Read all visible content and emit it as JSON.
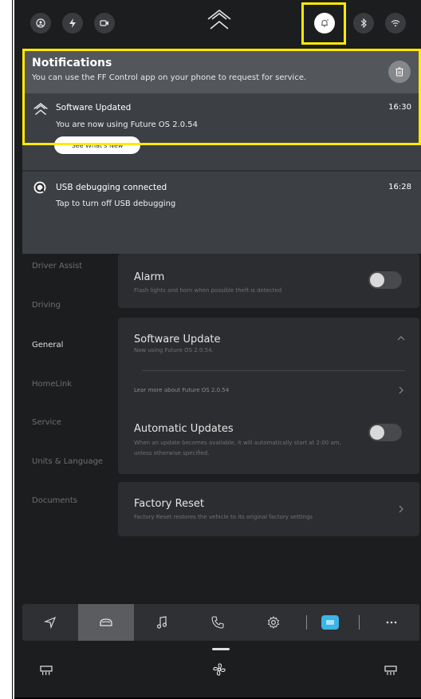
{
  "notifications": {
    "title": "Notifications",
    "subtitle": "You can use the FF Control app on your phone to request for service.",
    "items": [
      {
        "title": "Software Updated",
        "time": "16:30",
        "text": "You are now using Future OS 2.0.54",
        "action_label": "See What's New"
      },
      {
        "title": "USB debugging connected",
        "time": "16:28",
        "text": "Tap to turn off USB debugging"
      }
    ]
  },
  "sidebar": {
    "items": [
      {
        "label": "Driver Assist"
      },
      {
        "label": "Driving"
      },
      {
        "label": "General"
      },
      {
        "label": "HomeLink"
      },
      {
        "label": "Service"
      },
      {
        "label": "Units & Language"
      },
      {
        "label": "Documents"
      }
    ],
    "active": "General"
  },
  "settings": {
    "alarm": {
      "title": "Alarm",
      "desc": "Flash lights and horn when possible theft is detected",
      "enabled": false
    },
    "software_update": {
      "title": "Software Update",
      "desc": "Now using Future OS 2.0.54.",
      "link": "Lear more about Future OS 2.0.54"
    },
    "automatic_updates": {
      "title": "Automatic Updates",
      "desc_line1": "When an update becomes available, it will automatically start at 2:00 am,",
      "desc_line2": "unless otherwise specified.",
      "enabled": false
    },
    "factory_reset": {
      "title": "Factory Reset",
      "desc": "Factory Reset restores the vehicle to its original factory settings"
    }
  },
  "icons": {
    "top_left": [
      "user-icon",
      "bolt-icon",
      "camera-icon"
    ],
    "top_right": [
      "bell-icon",
      "bluetooth-icon",
      "wifi-icon"
    ],
    "nav": [
      "navigation-icon",
      "car-icon",
      "music-icon",
      "phone-icon",
      "settings-icon",
      "app-icon",
      "more-icon"
    ],
    "climate": [
      "rear-defrost-icon",
      "fan-icon",
      "rear-defrost-icon-right"
    ]
  },
  "colors": {
    "background": "#1c1d1f",
    "highlight": "#ffea00",
    "app_accent": "#3bb4e6"
  }
}
